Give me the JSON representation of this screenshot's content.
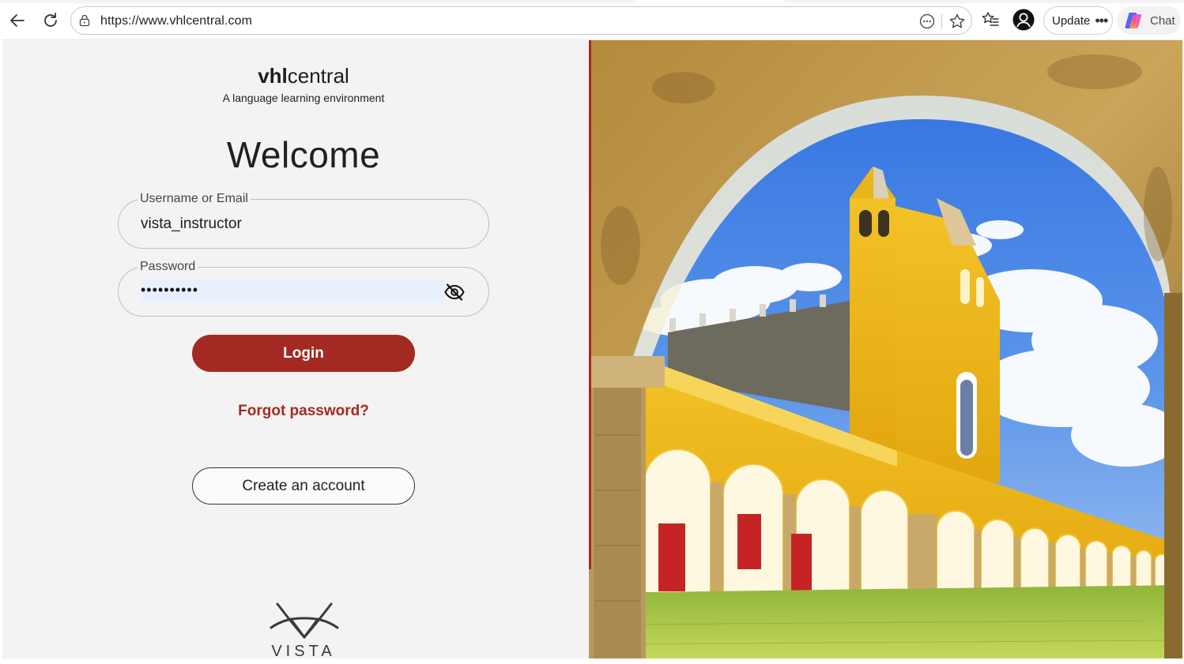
{
  "browser": {
    "url": "https://www.vhlcentral.com",
    "update_label": "Update",
    "chat_label": "Chat"
  },
  "brand": {
    "name_bold": "vhl",
    "name_light": "central",
    "tagline": "A language learning environment"
  },
  "login": {
    "heading": "Welcome",
    "username_label": "Username or Email",
    "username_value": "vista_instructor",
    "password_label": "Password",
    "password_value": "••••••••••",
    "login_button": "Login",
    "forgot_link": "Forgot password?",
    "create_account_button": "Create an account"
  },
  "footer_logo": {
    "text": "VISTA"
  },
  "colors": {
    "accent": "#a32a22",
    "autofill": "#e8f0fe",
    "page_bg": "#f3f3f3"
  },
  "icons": [
    "back-arrow-icon",
    "reload-icon",
    "lock-icon",
    "reader-view-icon",
    "favorite-star-icon",
    "collections-icon",
    "profile-icon",
    "more-dots-icon",
    "copilot-icon",
    "eye-slash-icon"
  ]
}
